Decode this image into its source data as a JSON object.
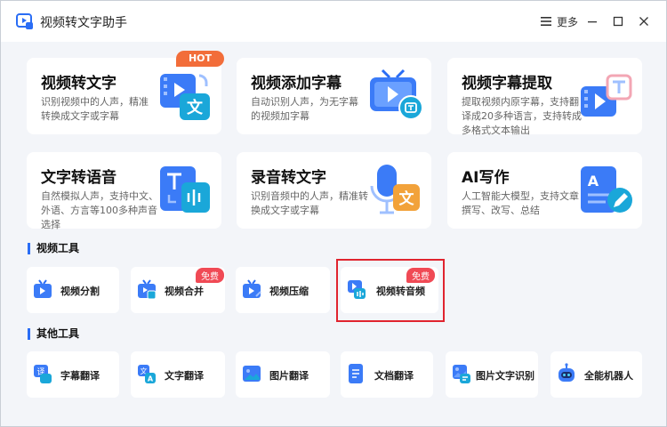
{
  "app": {
    "title": "视频转文字助手"
  },
  "titlebar": {
    "more_label": "更多"
  },
  "feature_cards": [
    {
      "title": "视频转文字",
      "desc": "识别视频中的人声，精准转换成文字或字幕",
      "badge": "HOT"
    },
    {
      "title": "视频添加字幕",
      "desc": "自动识别人声，为无字幕的视频加字幕"
    },
    {
      "title": "视频字幕提取",
      "desc": "提取视频内原字幕，支持翻译成20多种语言，支持转成多格式文本输出"
    },
    {
      "title": "文字转语音",
      "desc": "自然模拟人声，支持中文、外语、方言等100多种声音选择"
    },
    {
      "title": "录音转文字",
      "desc": "识别音频中的人声，精准转换成文字或字幕"
    },
    {
      "title": "AI写作",
      "desc": "人工智能大模型，支持文章撰写、改写、总结"
    }
  ],
  "video_tools": {
    "title": "视频工具",
    "items": [
      {
        "label": "视频分割"
      },
      {
        "label": "视频合并",
        "badge": "免费"
      },
      {
        "label": "视频压缩"
      },
      {
        "label": "视频转音频",
        "badge": "免费"
      }
    ]
  },
  "other_tools": {
    "title": "其他工具",
    "items": [
      {
        "label": "字幕翻译"
      },
      {
        "label": "文字翻译"
      },
      {
        "label": "图片翻译"
      },
      {
        "label": "文档翻译"
      },
      {
        "label": "图片文字识别"
      },
      {
        "label": "全能机器人"
      }
    ]
  },
  "colors": {
    "accent": "#2a6df5",
    "badge": "#f04a55",
    "hot": "#f26d3a",
    "highlight": "#e0242f",
    "background": "#f3f5f9"
  }
}
